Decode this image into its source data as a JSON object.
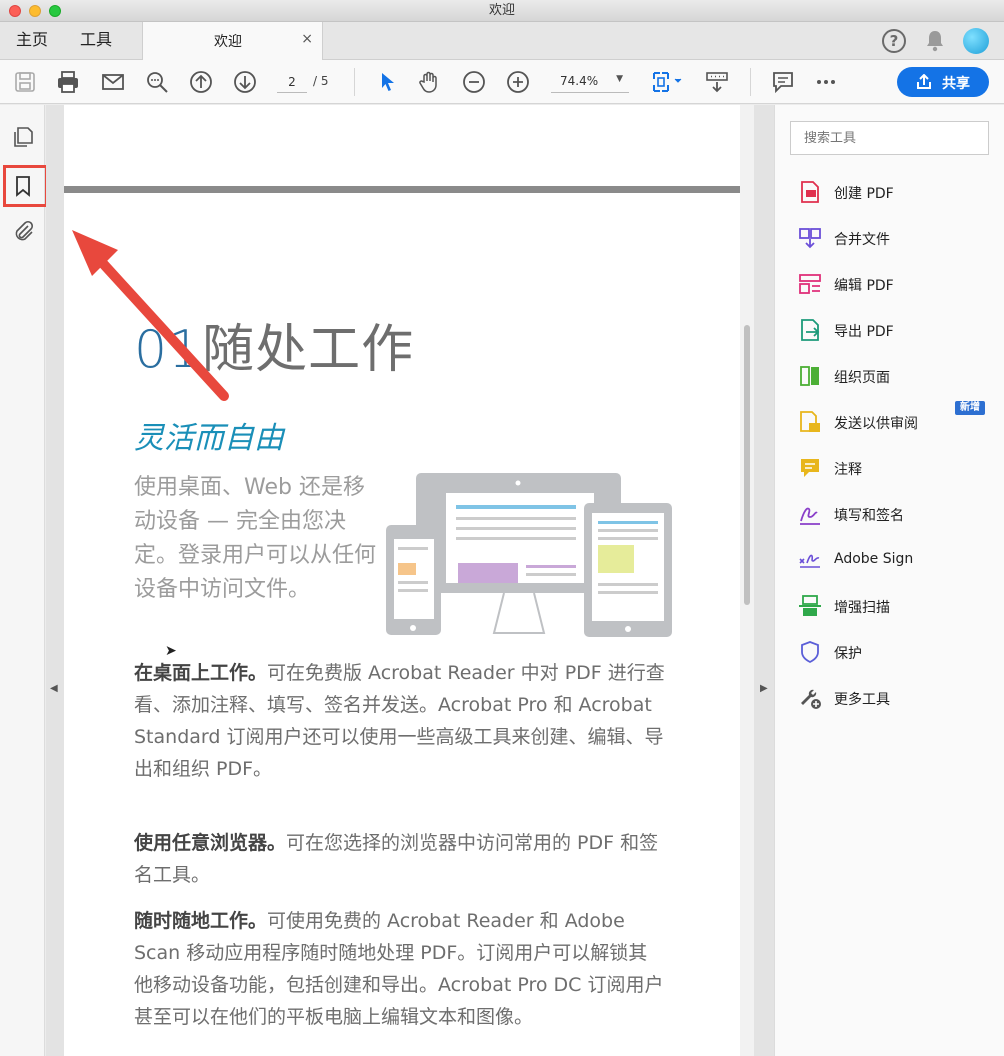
{
  "window": {
    "title": "欢迎"
  },
  "tabs": {
    "home": "主页",
    "tools": "工具",
    "document": "欢迎",
    "close": "×"
  },
  "header": {
    "help": "?"
  },
  "toolbar": {
    "page_current": "2",
    "page_total": "/ 5",
    "zoom": "74.4%",
    "share_label": "共享"
  },
  "document": {
    "heading_num": "01",
    "heading_text": "随处工作",
    "subheading": "灵活而自由",
    "intro": "使用桌面、Web 还是移动设备 — 完全由您决定。登录用户可以从任何设备中访问文件。",
    "paragraphs": [
      {
        "lead": "在桌面上工作。",
        "body": "可在免费版 Acrobat Reader 中对 PDF 进行查看、添加注释、填写、签名并发送。Acrobat Pro 和 Acrobat Standard 订阅用户还可以使用一些高级工具来创建、编辑、导出和组织 PDF。"
      },
      {
        "lead": "使用任意浏览器。",
        "body": "可在您选择的浏览器中访问常用的 PDF 和签名工具。"
      },
      {
        "lead": "随时随地工作。",
        "body": "可使用免费的 Acrobat Reader 和 Adobe Scan 移动应用程序随时随地处理 PDF。订阅用户可以解锁其他移动设备功能，包括创建和导出。Acrobat Pro DC 订阅用户甚至可以在他们的平板电脑上编辑文本和图像。"
      }
    ]
  },
  "tools_panel": {
    "search_placeholder": "搜索工具",
    "new_badge": "新增",
    "items": [
      {
        "label": "创建 PDF",
        "icon": "create-pdf-icon",
        "color": "#e0304e"
      },
      {
        "label": "合并文件",
        "icon": "combine-files-icon",
        "color": "#6b4fd8"
      },
      {
        "label": "编辑 PDF",
        "icon": "edit-pdf-icon",
        "color": "#e0307a"
      },
      {
        "label": "导出 PDF",
        "icon": "export-pdf-icon",
        "color": "#1c9a7a"
      },
      {
        "label": "组织页面",
        "icon": "organize-pages-icon",
        "color": "#4caf35"
      },
      {
        "label": "发送以供审阅",
        "icon": "send-review-icon",
        "color": "#e8b61c"
      },
      {
        "label": "注释",
        "icon": "comment-icon",
        "color": "#e8b61c"
      },
      {
        "label": "填写和签名",
        "icon": "fill-sign-icon",
        "color": "#8a3fc9"
      },
      {
        "label": "Adobe Sign",
        "icon": "adobe-sign-icon",
        "color": "#6b4fd8"
      },
      {
        "label": "增强扫描",
        "icon": "enhance-scan-icon",
        "color": "#2fa84a"
      },
      {
        "label": "保护",
        "icon": "protect-icon",
        "color": "#5b5fd8"
      },
      {
        "label": "更多工具",
        "icon": "more-tools-icon",
        "color": "#555555"
      }
    ]
  }
}
